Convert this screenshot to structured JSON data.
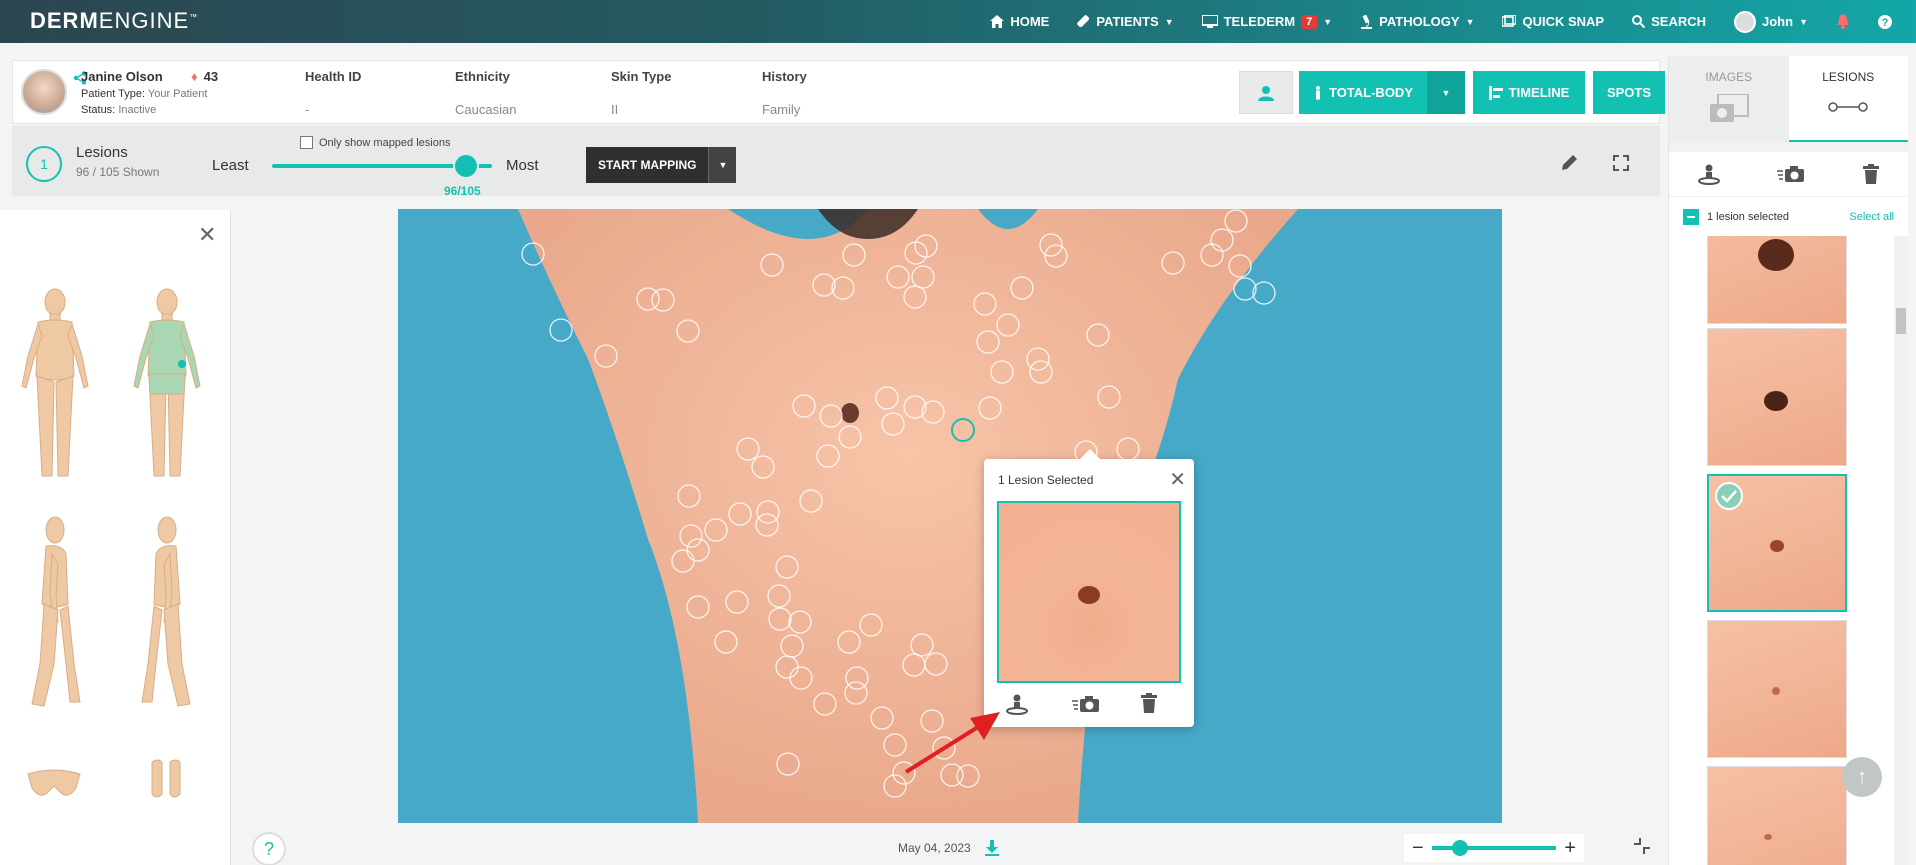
{
  "app": {
    "logo_bold": "DERM",
    "logo_light": "ENGINE",
    "logo_tm": "™"
  },
  "nav": {
    "home": "HOME",
    "patients": "PATIENTS",
    "telederm": "TELEDERM",
    "telederm_badge": "7",
    "pathology": "PATHOLOGY",
    "quick_snap": "QUICK SNAP",
    "search": "SEARCH",
    "user": "John"
  },
  "patient": {
    "name": "Janine Olson",
    "age": "43",
    "type_label": "Patient Type:",
    "type_value": "Your Patient",
    "status_label": "Status:",
    "status_value": "Inactive",
    "cols": [
      {
        "header": "Health ID",
        "value": "-"
      },
      {
        "header": "Ethnicity",
        "value": "Caucasian"
      },
      {
        "header": "Skin Type",
        "value": "II"
      },
      {
        "header": "History",
        "value": "Family"
      }
    ],
    "buttons": {
      "total_body": "TOTAL-BODY",
      "timeline": "TIMELINE",
      "spots": "SPOTS"
    }
  },
  "toolbar": {
    "count": "1",
    "title": "Lesions",
    "shown": "96 / 105 Shown",
    "checkbox_label": "Only show mapped lesions",
    "least": "Least",
    "most": "Most",
    "slider_value": "96/105",
    "slider_fraction": 0.914,
    "start_mapping": "START MAPPING"
  },
  "viewer": {
    "date": "May 04, 2023"
  },
  "popup": {
    "title": "1 Lesion Selected"
  },
  "right": {
    "tab_images": "IMAGES",
    "tab_lesions": "LESIONS",
    "selected_text": "1 lesion selected",
    "select_all": "Select all"
  },
  "colors": {
    "accent": "#13c1b3",
    "header_dark": "#2c4650",
    "badge": "#e53935"
  }
}
